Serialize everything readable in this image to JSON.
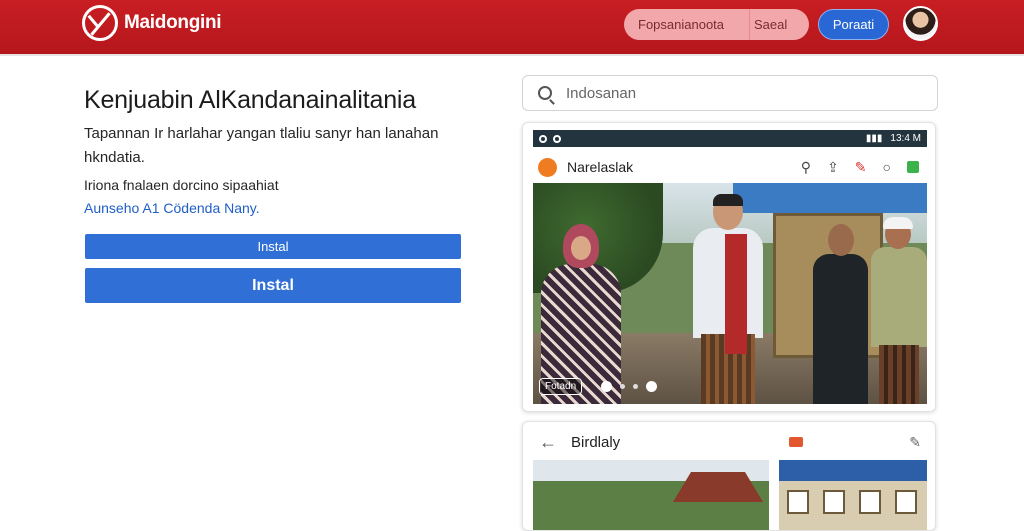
{
  "header": {
    "brand": "Maidongini",
    "search_left": "Fopsanianoota",
    "search_right": "Saeal",
    "login_label": "Poraati"
  },
  "main": {
    "headline": "Kenjuabin AlKandanainalitania",
    "description": "Tapannan Ir harlahar yangan tlaliu sanyr han lanahan hkndatia.",
    "subtext": "Iriona fnalaen dorcino sipaahiat",
    "link": "Aunseho A1 Cödenda Nany.",
    "install_small": "Instal",
    "install_large": "Instal"
  },
  "right": {
    "search_placeholder": "Indosanan",
    "phone": {
      "time": "13:4 M",
      "app_title": "Narelaslak",
      "photo_tag": "Fotadn"
    },
    "card2": {
      "title": "Birdlaly"
    }
  },
  "colors": {
    "header_red": "#c81e23",
    "primary_blue": "#2f6fd6",
    "link_blue": "#1f5fc8"
  },
  "icons": [
    "logo-icon",
    "search-icon",
    "avatar",
    "notification-icon",
    "more-icon",
    "back-arrow-icon",
    "pin-icon"
  ]
}
